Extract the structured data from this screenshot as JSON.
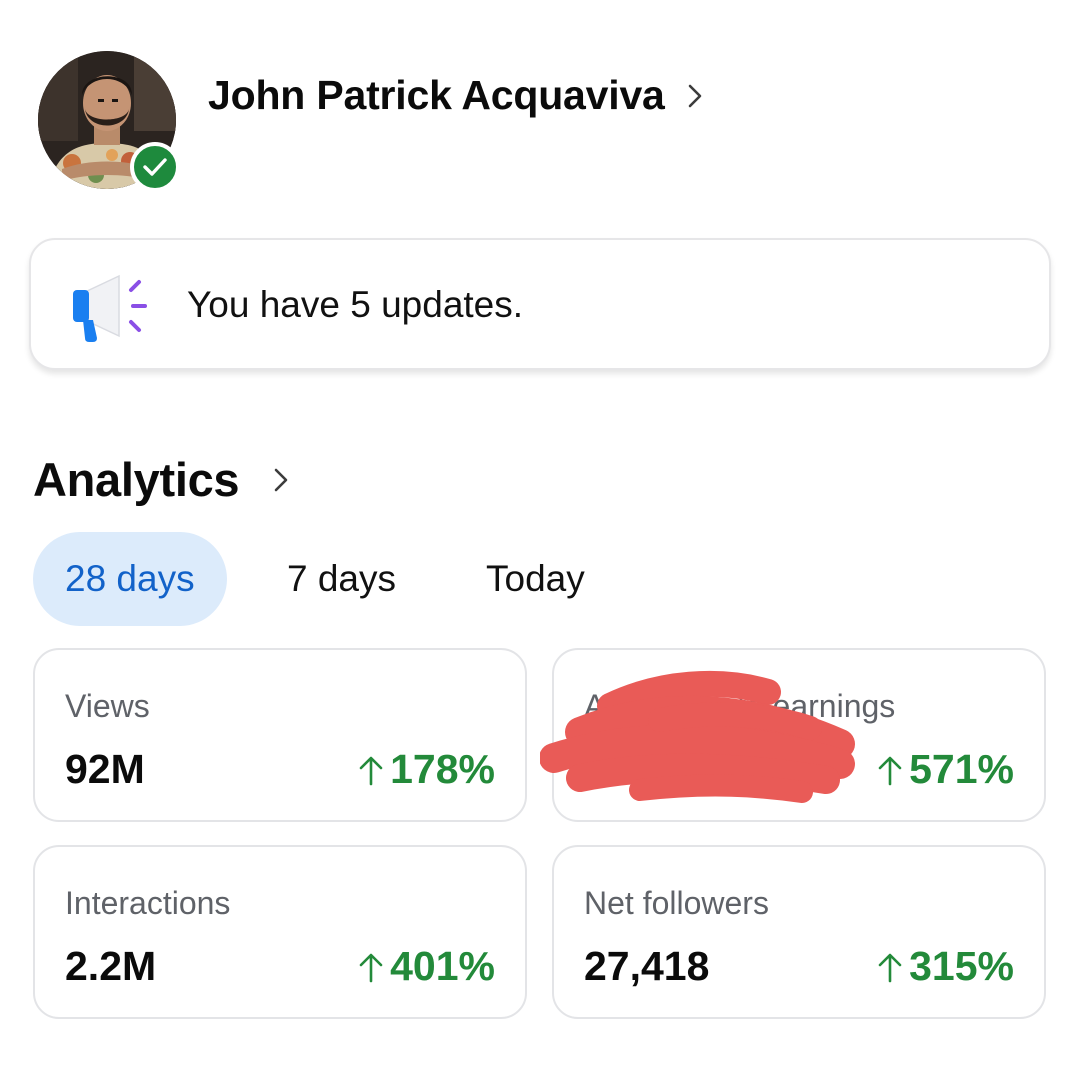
{
  "profile": {
    "name": "John Patrick Acquaviva",
    "avatar_icon": "profile-photo",
    "verified_icon": "check-icon",
    "verified_color": "#1e8a3d"
  },
  "updates": {
    "text": "You have 5 updates.",
    "icon": "megaphone-icon"
  },
  "analytics": {
    "title": "Analytics",
    "tabs": [
      {
        "label": "28 days",
        "active": true
      },
      {
        "label": "7 days",
        "active": false
      },
      {
        "label": "Today",
        "active": false
      }
    ],
    "cards": [
      {
        "label": "Views",
        "value": "92M",
        "change": "178%"
      },
      {
        "label": "Approximate earnings",
        "value": "",
        "change": "571%"
      },
      {
        "label": "Interactions",
        "value": "2.2M",
        "change": "401%"
      },
      {
        "label": "Net followers",
        "value": "27,418",
        "change": "315%"
      }
    ]
  },
  "colors": {
    "accent_blue": "#1262c9",
    "tab_active_bg": "#dcebfb",
    "positive_green": "#238a3a",
    "redaction": "#e95b57"
  }
}
